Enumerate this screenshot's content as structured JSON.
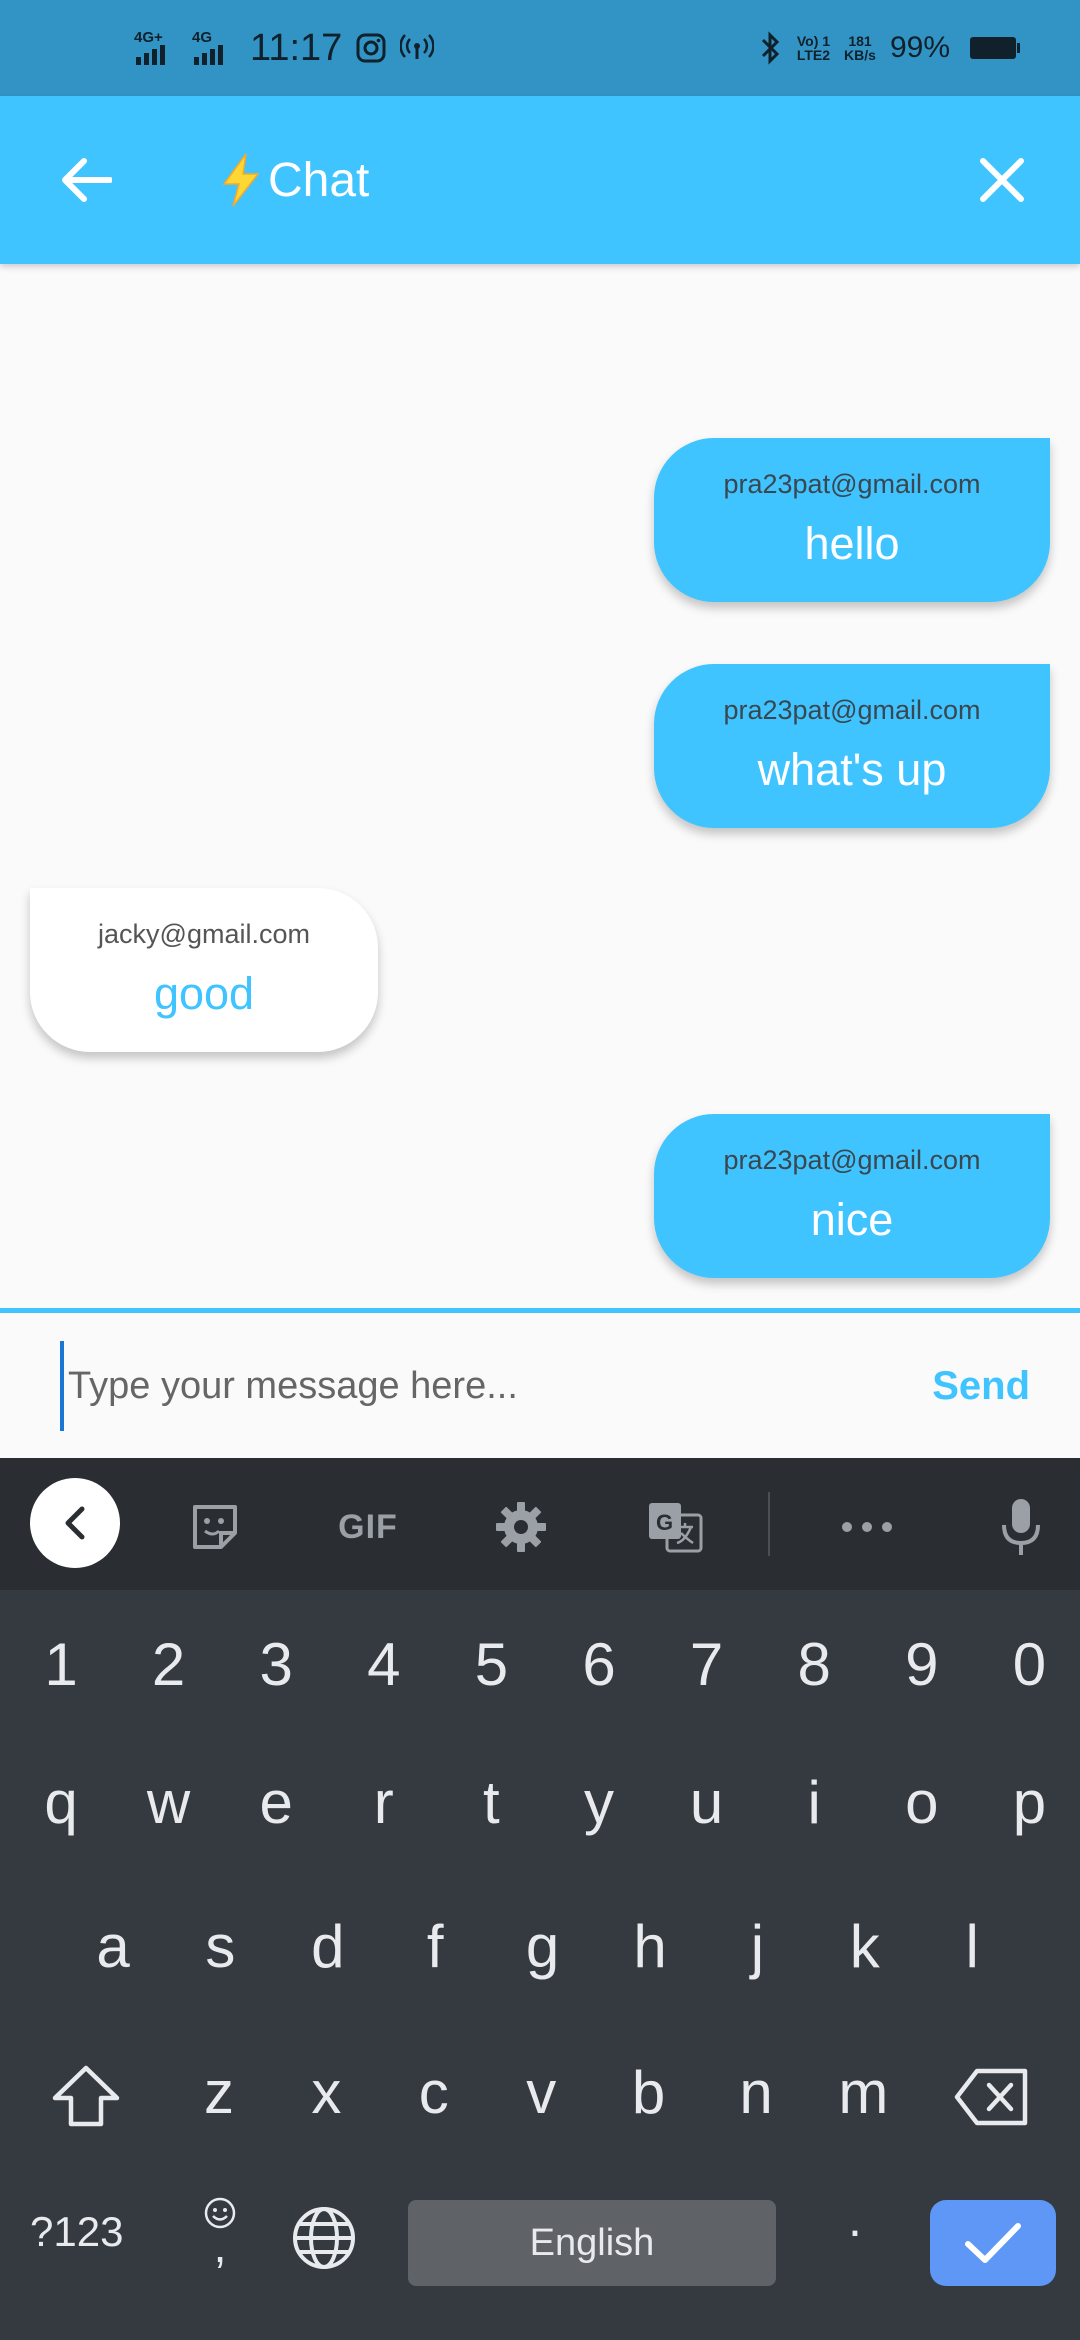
{
  "status_bar": {
    "net1": "4G+",
    "net2": "4G",
    "time": "11:17",
    "volte_top": "Vo) 1",
    "volte_bottom": "LTE2",
    "speed_top": "181",
    "speed_bottom": "KB/s",
    "battery": "99%"
  },
  "app_bar": {
    "title": "Chat",
    "back_icon": "arrow-left-icon",
    "close_icon": "close-icon",
    "bolt_icon": "lightning-bolt-icon"
  },
  "messages": [
    {
      "sender": "pra23pat@gmail.com",
      "text": "hello",
      "mine": true
    },
    {
      "sender": "pra23pat@gmail.com",
      "text": "what's up",
      "mine": true
    },
    {
      "sender": "jacky@gmail.com",
      "text": "good",
      "mine": false
    },
    {
      "sender": "pra23pat@gmail.com",
      "text": "nice",
      "mine": true
    }
  ],
  "input": {
    "placeholder": "Type your message here...",
    "value": "",
    "send_label": "Send"
  },
  "keyboard": {
    "toolbar": {
      "gif_label": "GIF"
    },
    "number_row": [
      "1",
      "2",
      "3",
      "4",
      "5",
      "6",
      "7",
      "8",
      "9",
      "0"
    ],
    "row1": [
      "q",
      "w",
      "e",
      "r",
      "t",
      "y",
      "u",
      "i",
      "o",
      "p"
    ],
    "row2": [
      "a",
      "s",
      "d",
      "f",
      "g",
      "h",
      "j",
      "k",
      "l"
    ],
    "row3": [
      "z",
      "x",
      "c",
      "v",
      "b",
      "n",
      "m"
    ],
    "symbols_label": "?123",
    "comma_label": ",",
    "space_label": "English",
    "period_label": "."
  },
  "colors": {
    "accent": "#40c4ff",
    "status_bar": "#3294c4",
    "keyboard_bg": "#353a40",
    "enter_key": "#5e97f6"
  }
}
